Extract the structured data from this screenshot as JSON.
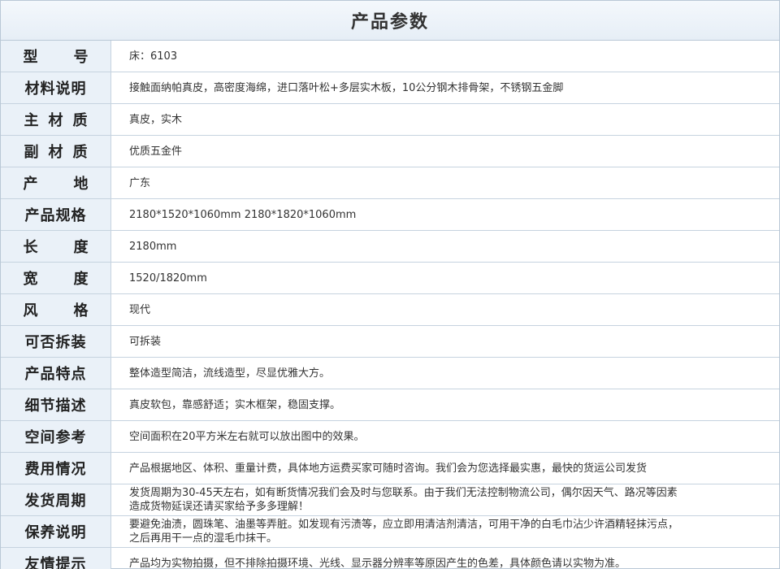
{
  "title": "产品参数",
  "rows": [
    {
      "label": "型号",
      "value": "床：6103"
    },
    {
      "label": "材料说明",
      "value": "接触面纳帕真皮，高密度海绵，进口落叶松+多层实木板，10公分钢木排骨架，不锈钢五金脚"
    },
    {
      "label": "主材质",
      "value": "真皮，实木"
    },
    {
      "label": "副材质",
      "value": "优质五金件"
    },
    {
      "label": "产地",
      "value": "广东"
    },
    {
      "label": "产品规格",
      "value": "2180*1520*1060mm  2180*1820*1060mm"
    },
    {
      "label": "长度",
      "value": "2180mm"
    },
    {
      "label": "宽度",
      "value": "1520/1820mm"
    },
    {
      "label": "风格",
      "value": "现代"
    },
    {
      "label": "可否拆装",
      "value": "可拆装"
    },
    {
      "label": "产品特点",
      "value": "整体造型简洁，流线造型，尽显优雅大方。"
    },
    {
      "label": "细节描述",
      "value": "真皮软包，靠感舒适；实木框架，稳固支撑。"
    },
    {
      "label": "空间参考",
      "value": "空间面积在20平方米左右就可以放出图中的效果。"
    },
    {
      "label": "费用情况",
      "value": "产品根据地区、体积、重量计费，具体地方运费买家可随时咨询。我们会为您选择最实惠，最快的货运公司发货"
    },
    {
      "label": "发货周期",
      "value": "发货周期为30-45天左右，如有断货情况我们会及时与您联系。由于我们无法控制物流公司，偶尔因天气、路况等因素\n造成货物延误还请买家给予多多理解！"
    },
    {
      "label": "保养说明",
      "value": "要避免油渍，圆珠笔、油墨等弄脏。如发现有污渍等，应立即用清洁剂清洁，可用干净的白毛巾沾少许酒精轻抹污点，\n之后再用干一点的湿毛巾抹干。"
    },
    {
      "label": "友情提示",
      "value": "产品均为实物拍摄，但不排除拍摄环境、光线、显示器分辨率等原因产生的色差，具体颜色请以实物为准。"
    }
  ]
}
